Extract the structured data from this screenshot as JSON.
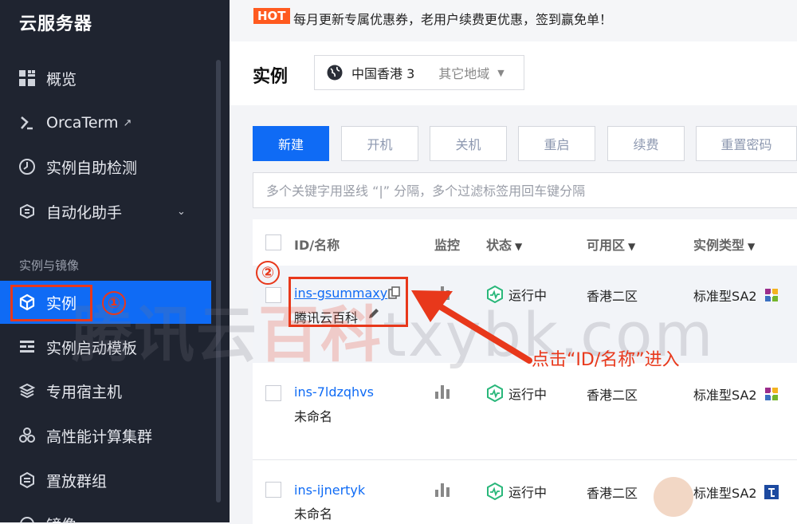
{
  "sidebar": {
    "title": "云服务器",
    "items": [
      {
        "label": "概览",
        "icon": "grid-icon"
      },
      {
        "label": "OrcaTerm",
        "icon": "orcaterm-icon"
      },
      {
        "label": "实例自助检测",
        "icon": "diagnose-icon"
      },
      {
        "label": "自动化助手",
        "icon": "automation-icon"
      }
    ],
    "section_label": "实例与镜像",
    "section_items": [
      {
        "label": "实例",
        "icon": "cube-icon",
        "active": true
      },
      {
        "label": "实例启动模板",
        "icon": "template-icon"
      },
      {
        "label": "专用宿主机",
        "icon": "host-icon"
      },
      {
        "label": "高性能计算集群",
        "icon": "cluster-icon"
      },
      {
        "label": "置放群组",
        "icon": "placement-icon"
      },
      {
        "label": "镜像",
        "icon": "image-icon"
      }
    ]
  },
  "promo": {
    "badge": "HOT",
    "text": "每月更新专属优惠券，老用户续费更优惠，签到赢免单！"
  },
  "header": {
    "title": "实例",
    "region": {
      "current": "中国香港 3",
      "other": "其它地域"
    }
  },
  "toolbar": {
    "new": "新建",
    "start": "开机",
    "stop": "关机",
    "restart": "重启",
    "renew": "续费",
    "reset_password": "重置密码"
  },
  "search": {
    "placeholder": "多个关键字用竖线 “|” 分隔，多个过滤标签用回车键分隔"
  },
  "table": {
    "columns": [
      "ID/名称",
      "监控",
      "状态",
      "可用区",
      "实例类型"
    ],
    "rows": [
      {
        "id": "ins-gsummaxy",
        "name": "腾讯云百科",
        "status": "运行中",
        "zone": "香港二区",
        "type": "标准型SA2",
        "os": "centos-icon"
      },
      {
        "id": "ins-7ldzqhvs",
        "name": "未命名",
        "status": "运行中",
        "zone": "香港二区",
        "type": "标准型SA2",
        "os": "centos-icon"
      },
      {
        "id": "ins-ijnertyk",
        "name": "未命名",
        "status": "运行中",
        "zone": "香港二区",
        "type": "标准型SA2",
        "os": "tencentos-icon"
      }
    ]
  },
  "annotations": {
    "step1": "①",
    "step2": "②",
    "hint": "点击“ID/名称”进入",
    "watermark": [
      "腾讯云",
      "百科",
      "txybk.com"
    ],
    "color": "#e8381b"
  },
  "colors": {
    "accent": "#0f6bf5",
    "sidebar_bg": "#1f2430",
    "hot": "#ff5a1f"
  }
}
